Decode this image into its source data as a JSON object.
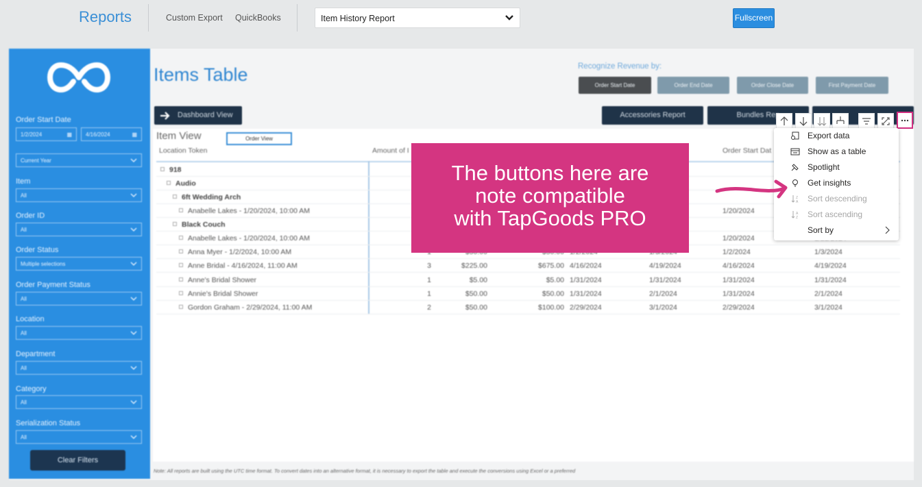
{
  "topbar": {
    "brand": "Reports",
    "links": [
      "Custom Export",
      "QuickBooks"
    ],
    "report_select_value": "Item History Report",
    "fullscreen_label": "Fullscreen"
  },
  "sidebar": {
    "filters": [
      {
        "label": "Order Start Date",
        "start": "1/2/2024",
        "end": "4/16/2024"
      },
      {
        "label": "",
        "value": "Current Year"
      },
      {
        "label": "Item",
        "value": "All"
      },
      {
        "label": "Order ID",
        "value": "All"
      },
      {
        "label": "Order Status",
        "value": "Multiple selections"
      },
      {
        "label": "Order Payment Status",
        "value": "All"
      },
      {
        "label": "Location",
        "value": "All"
      },
      {
        "label": "Department",
        "value": "All"
      },
      {
        "label": "Category",
        "value": "All"
      },
      {
        "label": "Serialization Status",
        "value": "All"
      }
    ],
    "clear_filters": "Clear Filters"
  },
  "main": {
    "title": "Items Table",
    "recognize_label": "Recognize Revenue by:",
    "revenue_buttons": [
      "Order Start Date",
      "Order End Date",
      "Order Close Date",
      "First Payment Date"
    ],
    "dashboard_view": "Dashboard View",
    "report_buttons": [
      "Accessories Report",
      "Bundles Rep"
    ],
    "item_view": "Item View",
    "order_view": "Order View",
    "columns": [
      "Location Token",
      "Amount of I",
      "Order Start Dat"
    ],
    "rows": [
      {
        "label": "918",
        "level": 0,
        "bold": true
      },
      {
        "label": "Audio",
        "level": 1,
        "bold": true
      },
      {
        "label": "6ft Wedding Arch",
        "level": 2,
        "bold": true
      },
      {
        "label": "Anabelle Lakes - 1/20/2024, 10:00 AM",
        "level": 3,
        "d3": "1/20/2024"
      },
      {
        "label": "Black Couch",
        "level": 2,
        "bold": true
      },
      {
        "label": "Anabelle Lakes - 1/20/2024, 10:00 AM",
        "level": 3,
        "d3": "1/20/2024",
        "d4": "1/21/2024"
      },
      {
        "label": "Anna Myer - 1/2/2024, 10:00 AM",
        "level": 3,
        "qty": "1",
        "price": "$50.00",
        "total": "$50.00",
        "d1": "1/2/2024",
        "d2": "1/3/2024",
        "d3": "1/2/2024",
        "d4": "1/3/2024"
      },
      {
        "label": "Anne Bridal - 4/16/2024, 11:00 AM",
        "level": 3,
        "qty": "3",
        "price": "$225.00",
        "total": "$675.00",
        "d1": "4/16/2024",
        "d2": "4/19/2024",
        "d3": "4/16/2024",
        "d4": "4/19/2024"
      },
      {
        "label": "Anne's Bridal Shower",
        "level": 3,
        "qty": "1",
        "price": "$5.00",
        "total": "$5.00",
        "d1": "1/31/2024",
        "d2": "1/31/2024",
        "d3": "1/31/2024",
        "d4": "1/31/2024"
      },
      {
        "label": "Annie's Bridal Shower",
        "level": 3,
        "qty": "1",
        "price": "$50.00",
        "total": "$50.00",
        "d1": "1/31/2024",
        "d2": "2/1/2024",
        "d3": "1/31/2024",
        "d4": "2/1/2024"
      },
      {
        "label": "Gordon Graham - 2/29/2024, 11:00 AM",
        "level": 3,
        "qty": "2",
        "price": "$50.00",
        "total": "$100.00",
        "d1": "2/29/2024",
        "d2": "3/1/2024",
        "d3": "2/29/2024",
        "d4": "3/1/2024"
      }
    ],
    "footnote": "Note: All reports are built using the UTC time format. To convert dates into an alternative format, it is necessary to export the table and execute the conversions using Excel or a preferred"
  },
  "context_menu": {
    "items": [
      {
        "label": "Export data",
        "icon": "export-icon",
        "disabled": false
      },
      {
        "label": "Show as a table",
        "icon": "table-icon",
        "disabled": false
      },
      {
        "label": "Spotlight",
        "icon": "spotlight-icon",
        "disabled": false
      },
      {
        "label": "Get insights",
        "icon": "lightbulb-icon",
        "disabled": false
      },
      {
        "label": "Sort descending",
        "icon": "sort-descending-icon",
        "disabled": true
      },
      {
        "label": "Sort ascending",
        "icon": "sort-ascending-icon",
        "disabled": true
      },
      {
        "label": "Sort by",
        "icon": "",
        "disabled": false
      }
    ]
  },
  "callout": {
    "lines": [
      "The buttons here are",
      "note compatible",
      "with TapGoods PRO"
    ],
    "color": "#d43581"
  }
}
